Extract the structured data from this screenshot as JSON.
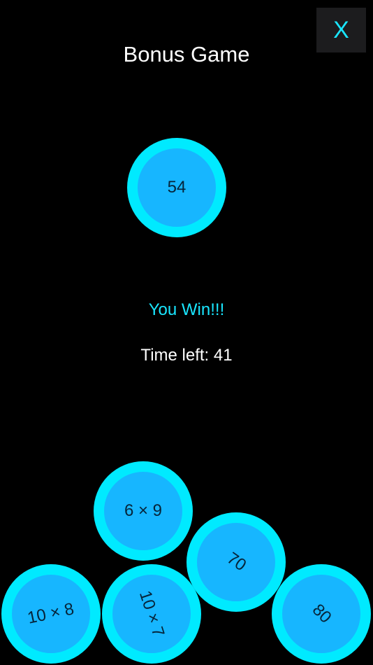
{
  "header": {
    "title": "Bonus Game",
    "close_label": "X"
  },
  "target": {
    "value": "54"
  },
  "status": {
    "message": "You Win!!!",
    "timer_text": "Time left: 41"
  },
  "balls": [
    {
      "label": "6 × 9"
    },
    {
      "label": "70"
    },
    {
      "label": "10 × 8"
    },
    {
      "label": "10 × 7"
    },
    {
      "label": "80"
    }
  ],
  "colors": {
    "background": "#000000",
    "accent": "#19e6ff",
    "ball_fill": "#17b6ff",
    "ball_ring": "#00eaff",
    "button_bg": "#1c1c1e"
  }
}
